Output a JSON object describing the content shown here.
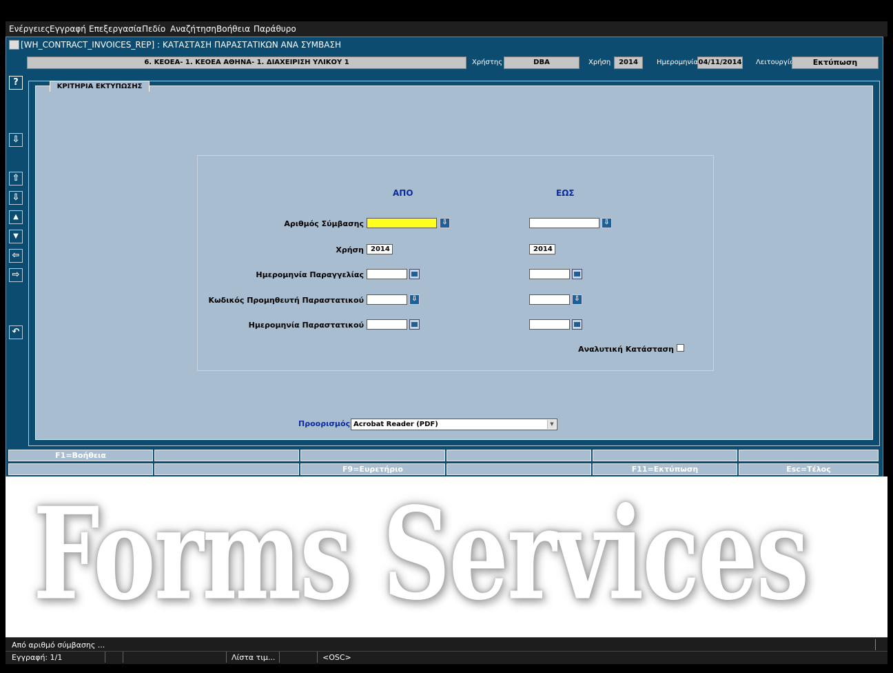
{
  "menu": [
    "Ενέργειες",
    "Εγγραφή",
    "Επεξεργασία",
    "Πεδίο",
    "Αναζήτηση",
    "Βοήθεια",
    "Παράθυρο"
  ],
  "window": {
    "title": "[WH_CONTRACT_INVOICES_REP]  :  ΚΑΤΑΣΤΑΣΗ ΠΑΡΑΣΤΑΤΙΚΩΝ ΑΝΑ ΣΥΜΒΑΣΗ"
  },
  "context": {
    "org": "6. ΚΕΟΕΑ- 1. ΚΕΟΕΑ ΑΘΗΝΑ- 1. ΔΙΑΧΕΙΡΙΣΗ ΥΛΙΚΟΥ 1",
    "user_label": "Χρήστης",
    "user": "DBA",
    "year_label": "Χρήση",
    "year": "2014",
    "date_label": "Ημερομηνία",
    "date": "04/11/2014",
    "mode_label": "Λειτουργία",
    "mode": "Εκτύπωση"
  },
  "toolbar": {
    "help": "?",
    "icons": [
      "download-icon",
      "first-record-icon",
      "last-record-icon",
      "prev-record-icon",
      "next-record-icon",
      "prev-block-icon",
      "next-block-icon",
      "undo-icon"
    ]
  },
  "form": {
    "tab_label": "ΚΡΙΤΗΡΙΑ ΕΚΤΥΠΩΣΗΣ",
    "from_header": "ΑΠΟ",
    "to_header": "ΕΩΣ",
    "rows": [
      {
        "label": "Αριθμός Σύμβασης",
        "from": "",
        "to": ""
      },
      {
        "label": "Χρήση",
        "from": "2014",
        "to": "2014"
      },
      {
        "label": "Ημερομηνία Παραγγελίας",
        "from": "",
        "to": ""
      },
      {
        "label": "Κωδικός Προμηθευτή Παραστατικού",
        "from": "",
        "to": ""
      },
      {
        "label": "Ημερομηνία Παραστατικού",
        "from": "",
        "to": ""
      }
    ],
    "detailed_label": "Αναλυτική Κατάσταση",
    "destination_label": "Προορισμός",
    "destination_value": "Acrobat Reader (PDF)"
  },
  "fkeys": {
    "row1": [
      "F1=Βοήθεια",
      "",
      "",
      "",
      "",
      ""
    ],
    "row2": [
      "",
      "",
      "F9=Ευρετήριο",
      "",
      "F11=Εκτύπωση",
      "Esc=Τέλος"
    ]
  },
  "watermark": "Forms Services",
  "status": {
    "message": "Από αριθμό σύμβασης ...",
    "record": "Εγγραφή: 1/1",
    "lov": "Λίστα τιμ...",
    "osc": "<OSC>"
  },
  "colors": {
    "window_bg": "#0c4c70",
    "panel_bg": "#a9bdd1",
    "required_field": "#ffff22",
    "header_text": "#0d2a9e"
  }
}
